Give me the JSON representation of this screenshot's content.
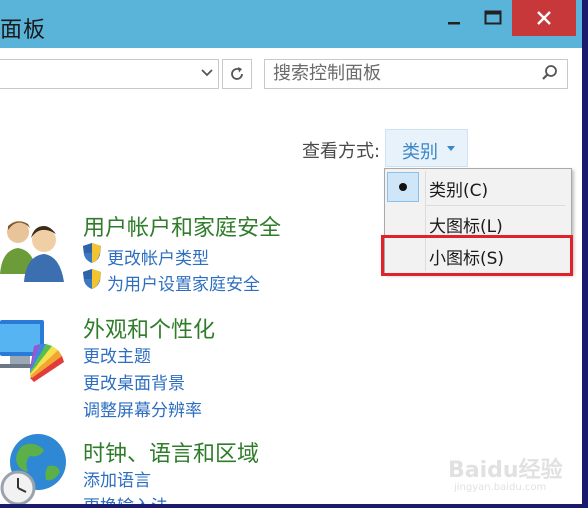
{
  "window": {
    "title": "面板",
    "controls": {
      "minimize": "minimize-icon",
      "maximize": "maximize-icon",
      "close": "close-icon"
    },
    "title_bar_color": "#5ab4d9",
    "close_color": "#c7383a"
  },
  "addressbar": {
    "search_placeholder": "搜索控制面板",
    "icons": {
      "dropdown": "chevron-down-icon",
      "refresh": "refresh-icon",
      "search": "search-icon"
    }
  },
  "view": {
    "label": "查看方式:",
    "current": "类别",
    "menu": [
      {
        "label": "类别(C)",
        "checked": true
      },
      {
        "label": "大图标(L)",
        "checked": false
      },
      {
        "label": "小图标(S)",
        "checked": false,
        "highlighted": true
      }
    ],
    "highlight_color": "#e0232a"
  },
  "categories": [
    {
      "title": "用户帐户和家庭安全",
      "icon": "users-icon",
      "links": [
        {
          "label": "更改帐户类型",
          "shield": true
        },
        {
          "label": "为用户设置家庭安全",
          "shield": true
        }
      ]
    },
    {
      "title": "外观和个性化",
      "icon": "display-color-icon",
      "links": [
        {
          "label": "更改主题"
        },
        {
          "label": "更改桌面背景"
        },
        {
          "label": "调整屏幕分辨率"
        }
      ]
    },
    {
      "title": "时钟、语言和区域",
      "icon": "globe-clock-icon",
      "links": [
        {
          "label": "添加语言"
        },
        {
          "label": "更换输入法"
        }
      ]
    }
  ],
  "watermark": {
    "brand": "Baidu经验",
    "url": "jingyan.baidu.com"
  },
  "colors": {
    "category_title": "#2f7d2a",
    "link": "#2d6ec0",
    "view_button": "#3a86c8"
  }
}
